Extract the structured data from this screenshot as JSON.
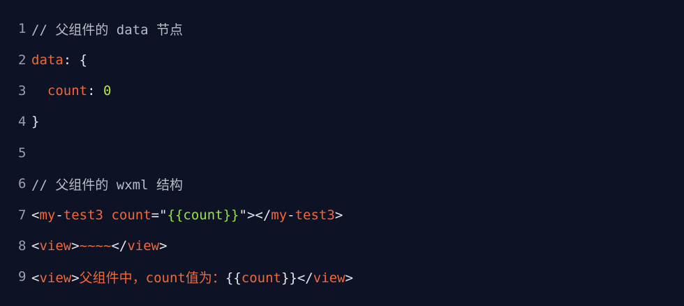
{
  "colors": {
    "background": "#0d1225",
    "line_number": "#9aa0ae",
    "comment": "#b7bcc6",
    "keyword": "#f0693a",
    "number": "#b6e24c",
    "string": "#9be04b",
    "punctuation": "#e6e8ee"
  },
  "lines": [
    {
      "num": "1",
      "tokens": [
        {
          "t": "// 父组件的 data 节点",
          "c": "comment"
        }
      ]
    },
    {
      "num": "2",
      "tokens": [
        {
          "t": "data",
          "c": "kw"
        },
        {
          "t": ": {",
          "c": "punc"
        }
      ]
    },
    {
      "num": "3",
      "tokens": [
        {
          "t": "  ",
          "c": "punc"
        },
        {
          "t": "count",
          "c": "kw"
        },
        {
          "t": ": ",
          "c": "punc"
        },
        {
          "t": "0",
          "c": "num"
        }
      ]
    },
    {
      "num": "4",
      "tokens": [
        {
          "t": "}",
          "c": "punc"
        }
      ]
    },
    {
      "num": "5",
      "tokens": []
    },
    {
      "num": "6",
      "tokens": [
        {
          "t": "// 父组件的 wxml 结构",
          "c": "comment"
        }
      ]
    },
    {
      "num": "7",
      "tokens": [
        {
          "t": "<",
          "c": "punc"
        },
        {
          "t": "my",
          "c": "tag"
        },
        {
          "t": "-",
          "c": "punc"
        },
        {
          "t": "test3",
          "c": "tag"
        },
        {
          "t": " ",
          "c": "punc"
        },
        {
          "t": "count",
          "c": "attr"
        },
        {
          "t": "=\"",
          "c": "punc"
        },
        {
          "t": "{{count}}",
          "c": "str"
        },
        {
          "t": "\"></",
          "c": "punc"
        },
        {
          "t": "my",
          "c": "tag"
        },
        {
          "t": "-",
          "c": "punc"
        },
        {
          "t": "test3",
          "c": "tag"
        },
        {
          "t": ">",
          "c": "punc"
        }
      ]
    },
    {
      "num": "8",
      "tokens": [
        {
          "t": "<",
          "c": "punc"
        },
        {
          "t": "view",
          "c": "tag"
        },
        {
          "t": ">",
          "c": "punc"
        },
        {
          "t": "~~~~",
          "c": "txt"
        },
        {
          "t": "</",
          "c": "punc"
        },
        {
          "t": "view",
          "c": "tag"
        },
        {
          "t": ">",
          "c": "punc"
        }
      ]
    },
    {
      "num": "9",
      "tokens": [
        {
          "t": "<",
          "c": "punc"
        },
        {
          "t": "view",
          "c": "tag"
        },
        {
          "t": ">",
          "c": "punc"
        },
        {
          "t": "父组件中，count值为：",
          "c": "txt"
        },
        {
          "t": "{{",
          "c": "punc"
        },
        {
          "t": "count",
          "c": "tag"
        },
        {
          "t": "}}",
          "c": "punc"
        },
        {
          "t": "</",
          "c": "punc"
        },
        {
          "t": "view",
          "c": "tag"
        },
        {
          "t": ">",
          "c": "punc"
        }
      ]
    }
  ]
}
